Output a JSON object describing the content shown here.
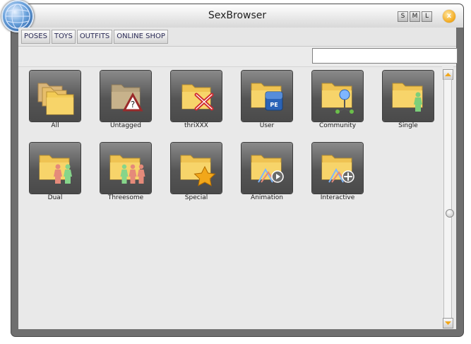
{
  "window": {
    "title": "SexBrowser",
    "size_buttons": [
      "S",
      "M",
      "L"
    ],
    "close_label": "x"
  },
  "toolbar": {
    "tabs": [
      "POSES",
      "TOYS",
      "OUTFITS",
      "ONLINE SHOP"
    ]
  },
  "search": {
    "placeholder": ""
  },
  "folders": [
    {
      "label": "All",
      "icon": "stacked-folders-icon"
    },
    {
      "label": "Untagged",
      "icon": "question-warning-icon"
    },
    {
      "label": "thriXXX",
      "icon": "thrixxx-logo-icon"
    },
    {
      "label": "User",
      "icon": "pe-badge-icon"
    },
    {
      "label": "Community",
      "icon": "community-network-icon"
    },
    {
      "label": "Single",
      "icon": "single-figure-icon"
    },
    {
      "label": "Dual",
      "icon": "dual-figures-icon"
    },
    {
      "label": "Threesome",
      "icon": "three-figures-icon"
    },
    {
      "label": "Special",
      "icon": "star-icon"
    },
    {
      "label": "Animation",
      "icon": "play-icon"
    },
    {
      "label": "Interactive",
      "icon": "plus-icon"
    }
  ],
  "colors": {
    "frame": "#6f6f6f",
    "panel": "#e9e9e9",
    "folder": "#f2c64e",
    "accent_orange": "#f2a71a"
  }
}
